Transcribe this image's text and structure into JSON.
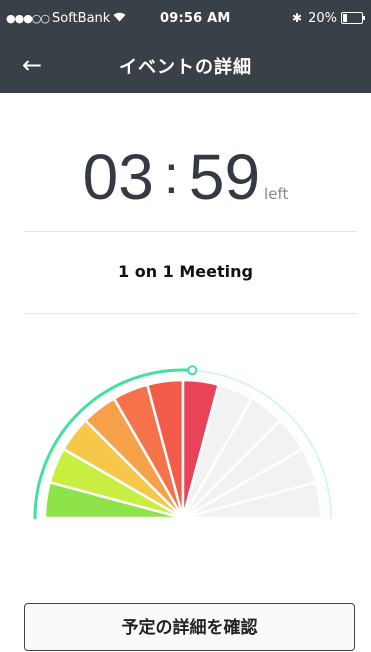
{
  "status_bar": {
    "signal": "●●●○○",
    "carrier": "SoftBank",
    "time": "09:56 AM",
    "bluetooth": "✱",
    "battery": "20%",
    "battery_level": 0.2
  },
  "nav": {
    "back_icon": "←",
    "title": "イベントの詳細"
  },
  "timer": {
    "minutes": "03",
    "separator": ":",
    "seconds": "59",
    "suffix": "left"
  },
  "event": {
    "title": "1 on 1 Meeting"
  },
  "gauge": {
    "segments_total": 12,
    "segments_filled": 6,
    "progress_fraction": 0.52,
    "filled_colors": [
      "#8ee24a",
      "#c7ee40",
      "#f5c84a",
      "#f7a04a",
      "#f5724a",
      "#f25a4a",
      "#e84359"
    ],
    "empty_color": "#f2f2f2",
    "arc_color": "#45e0a0"
  },
  "actions": {
    "confirm_label": "予定の詳細を確認"
  }
}
